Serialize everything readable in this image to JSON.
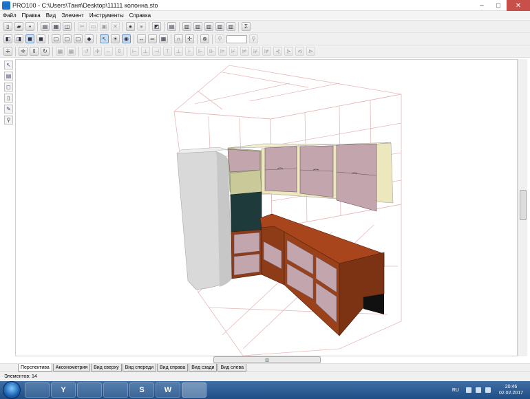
{
  "window": {
    "title": "PRO100 - C:\\Users\\Таня\\Desktop\\11111 колонна.sto"
  },
  "menu": [
    "Файл",
    "Правка",
    "Вид",
    "Элемент",
    "Инструменты",
    "Справка"
  ],
  "toolbar1": {
    "sum_label": "Σ"
  },
  "view_tabs": [
    "Перспектива",
    "Аксонометрия",
    "Вид сверху",
    "Вид спереди",
    "Вид справа",
    "Вид сзади",
    "Вид слева"
  ],
  "status": {
    "elements": "Элементов: 14"
  },
  "taskbar": {
    "apps": [
      {
        "name": "explorer",
        "label": ""
      },
      {
        "name": "yandex",
        "label": "Y"
      },
      {
        "name": "visual-studio",
        "label": ""
      },
      {
        "name": "utorrent",
        "label": ""
      },
      {
        "name": "skype",
        "label": "S"
      },
      {
        "name": "word",
        "label": "W"
      },
      {
        "name": "pro100",
        "label": ""
      }
    ],
    "lang": "RU",
    "time": "20:46",
    "date": "02.02.2017"
  },
  "colors": {
    "cabinet_front": "#c3a5ae",
    "cabinet_body": "#ece7bd",
    "countertop": "#8e3b18",
    "column": "#d9d9d9",
    "grid": "#e7b9b9",
    "fridge_dark": "#1f3a3a"
  }
}
